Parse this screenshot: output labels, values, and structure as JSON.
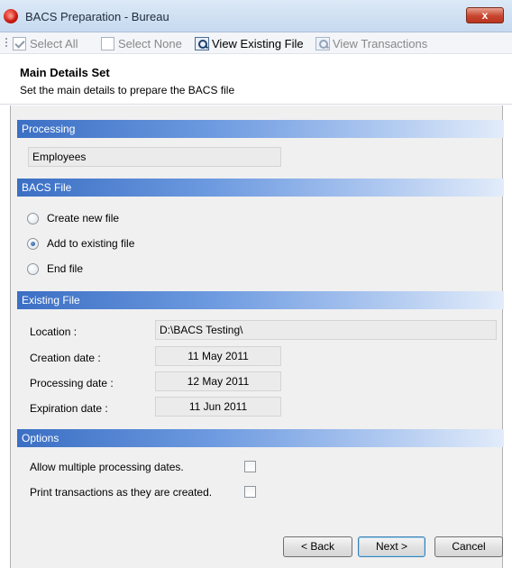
{
  "window": {
    "title": "BACS Preparation - Bureau",
    "close_glyph": "x"
  },
  "toolbar": {
    "select_all": "Select All",
    "select_none": "Select None",
    "view_existing_file": "View Existing File",
    "view_transactions": "View Transactions"
  },
  "header": {
    "title": "Main Details Set",
    "subtitle": "Set the main details to prepare the BACS file"
  },
  "processing": {
    "heading": "Processing",
    "value": "Employees"
  },
  "bacs_file": {
    "heading": "BACS File",
    "options": [
      "Create new file",
      "Add to existing file",
      "End file"
    ],
    "selected": "Add to existing file"
  },
  "existing_file": {
    "heading": "Existing File",
    "location_label": "Location :",
    "location_value": "D:\\BACS Testing\\",
    "creation_label": "Creation date :",
    "creation_value": "11 May 2011",
    "processing_label": "Processing date :",
    "processing_value": "12 May 2011",
    "expiration_label": "Expiration date :",
    "expiration_value": "11 Jun 2011"
  },
  "options": {
    "heading": "Options",
    "allow_multiple": "Allow multiple processing dates.",
    "allow_multiple_checked": false,
    "print_transactions": "Print transactions as they are created.",
    "print_transactions_checked": false
  },
  "buttons": {
    "back": "< Back",
    "next": "Next >",
    "cancel": "Cancel"
  }
}
